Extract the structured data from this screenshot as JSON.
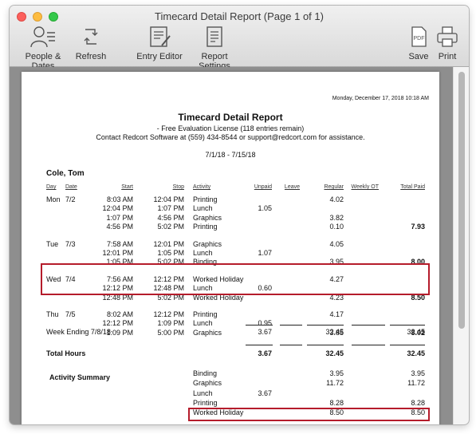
{
  "window": {
    "title": "Timecard Detail Report  (Page 1 of 1)"
  },
  "toolbar": {
    "people_dates": "People & Dates",
    "refresh": "Refresh",
    "entry_editor": "Entry Editor",
    "report_settings": "Report Settings",
    "save": "Save",
    "print": "Print",
    "pdf_glyph": "PDF"
  },
  "report": {
    "date_printed": "Monday, December 17, 2018  10:18 AM",
    "title": "Timecard Detail Report",
    "license": "- Free Evaluation License (118 entries remain)",
    "contact": "Contact Redcort Software at (559) 434-8544 or support@redcort.com for assistance.",
    "period": "7/1/18 - 7/15/18",
    "employee": "Cole, Tom",
    "headers": [
      "Day",
      "Date",
      "Start",
      "Stop",
      "Activity",
      "Unpaid",
      "Leave",
      "Regular",
      "Weekly OT",
      "Total Paid"
    ],
    "entries": [
      {
        "day": "Mon",
        "date": "7/2",
        "start": "8:03 AM",
        "stop": "12:04 PM",
        "activity": "Printing",
        "unpaid": "",
        "regular": "4.02",
        "total": ""
      },
      {
        "day": "",
        "date": "",
        "start": "12:04 PM",
        "stop": "1:07 PM",
        "activity": "Lunch",
        "unpaid": "1.05",
        "regular": "",
        "total": ""
      },
      {
        "day": "",
        "date": "",
        "start": "1:07 PM",
        "stop": "4:56 PM",
        "activity": "Graphics",
        "unpaid": "",
        "regular": "3.82",
        "total": ""
      },
      {
        "day": "",
        "date": "",
        "start": "4:56 PM",
        "stop": "5:02 PM",
        "activity": "Printing",
        "unpaid": "",
        "regular": "0.10",
        "total": "7.93"
      },
      {
        "day": "Tue",
        "date": "7/3",
        "start": "7:58 AM",
        "stop": "12:01 PM",
        "activity": "Graphics",
        "unpaid": "",
        "regular": "4.05",
        "total": ""
      },
      {
        "day": "",
        "date": "",
        "start": "12:01 PM",
        "stop": "1:05 PM",
        "activity": "Lunch",
        "unpaid": "1.07",
        "regular": "",
        "total": ""
      },
      {
        "day": "",
        "date": "",
        "start": "1:05 PM",
        "stop": "5:02 PM",
        "activity": "Binding",
        "unpaid": "",
        "regular": "3.95",
        "total": "8.00"
      },
      {
        "day": "Wed",
        "date": "7/4",
        "start": "7:56 AM",
        "stop": "12:12 PM",
        "activity": "Worked Holiday",
        "unpaid": "",
        "regular": "4.27",
        "total": ""
      },
      {
        "day": "",
        "date": "",
        "start": "12:12 PM",
        "stop": "12:48 PM",
        "activity": "Lunch",
        "unpaid": "0.60",
        "regular": "",
        "total": ""
      },
      {
        "day": "",
        "date": "",
        "start": "12:48 PM",
        "stop": "5:02 PM",
        "activity": "Worked Holiday",
        "unpaid": "",
        "regular": "4.23",
        "total": "8.50"
      },
      {
        "day": "Thu",
        "date": "7/5",
        "start": "8:02 AM",
        "stop": "12:12 PM",
        "activity": "Printing",
        "unpaid": "",
        "regular": "4.17",
        "total": ""
      },
      {
        "day": "",
        "date": "",
        "start": "12:12 PM",
        "stop": "1:09 PM",
        "activity": "Lunch",
        "unpaid": "0.95",
        "regular": "",
        "total": ""
      },
      {
        "day": "",
        "date": "",
        "start": "1:09 PM",
        "stop": "5:00 PM",
        "activity": "Graphics",
        "unpaid": "",
        "regular": "3.85",
        "total": "8.02"
      }
    ],
    "week_ending": {
      "label": "Week Ending 7/8/18",
      "unpaid": "3.67",
      "regular": "32.45",
      "total": "32.45"
    },
    "total_hours": {
      "label": "Total Hours",
      "unpaid": "3.67",
      "regular": "32.45",
      "total": "32.45"
    },
    "summary_label": "Activity Summary",
    "summary": [
      {
        "activity": "Binding",
        "unpaid": "",
        "regular": "3.95",
        "total": "3.95"
      },
      {
        "activity": "Graphics",
        "unpaid": "",
        "regular": "11.72",
        "total": "11.72"
      },
      {
        "activity": "Lunch",
        "unpaid": "3.67",
        "regular": "",
        "total": ""
      },
      {
        "activity": "Printing",
        "unpaid": "",
        "regular": "8.28",
        "total": "8.28"
      },
      {
        "activity": "Worked Holiday",
        "unpaid": "",
        "regular": "8.50",
        "total": "8.50"
      }
    ]
  },
  "colors": {
    "highlight": "#b51c2b"
  }
}
